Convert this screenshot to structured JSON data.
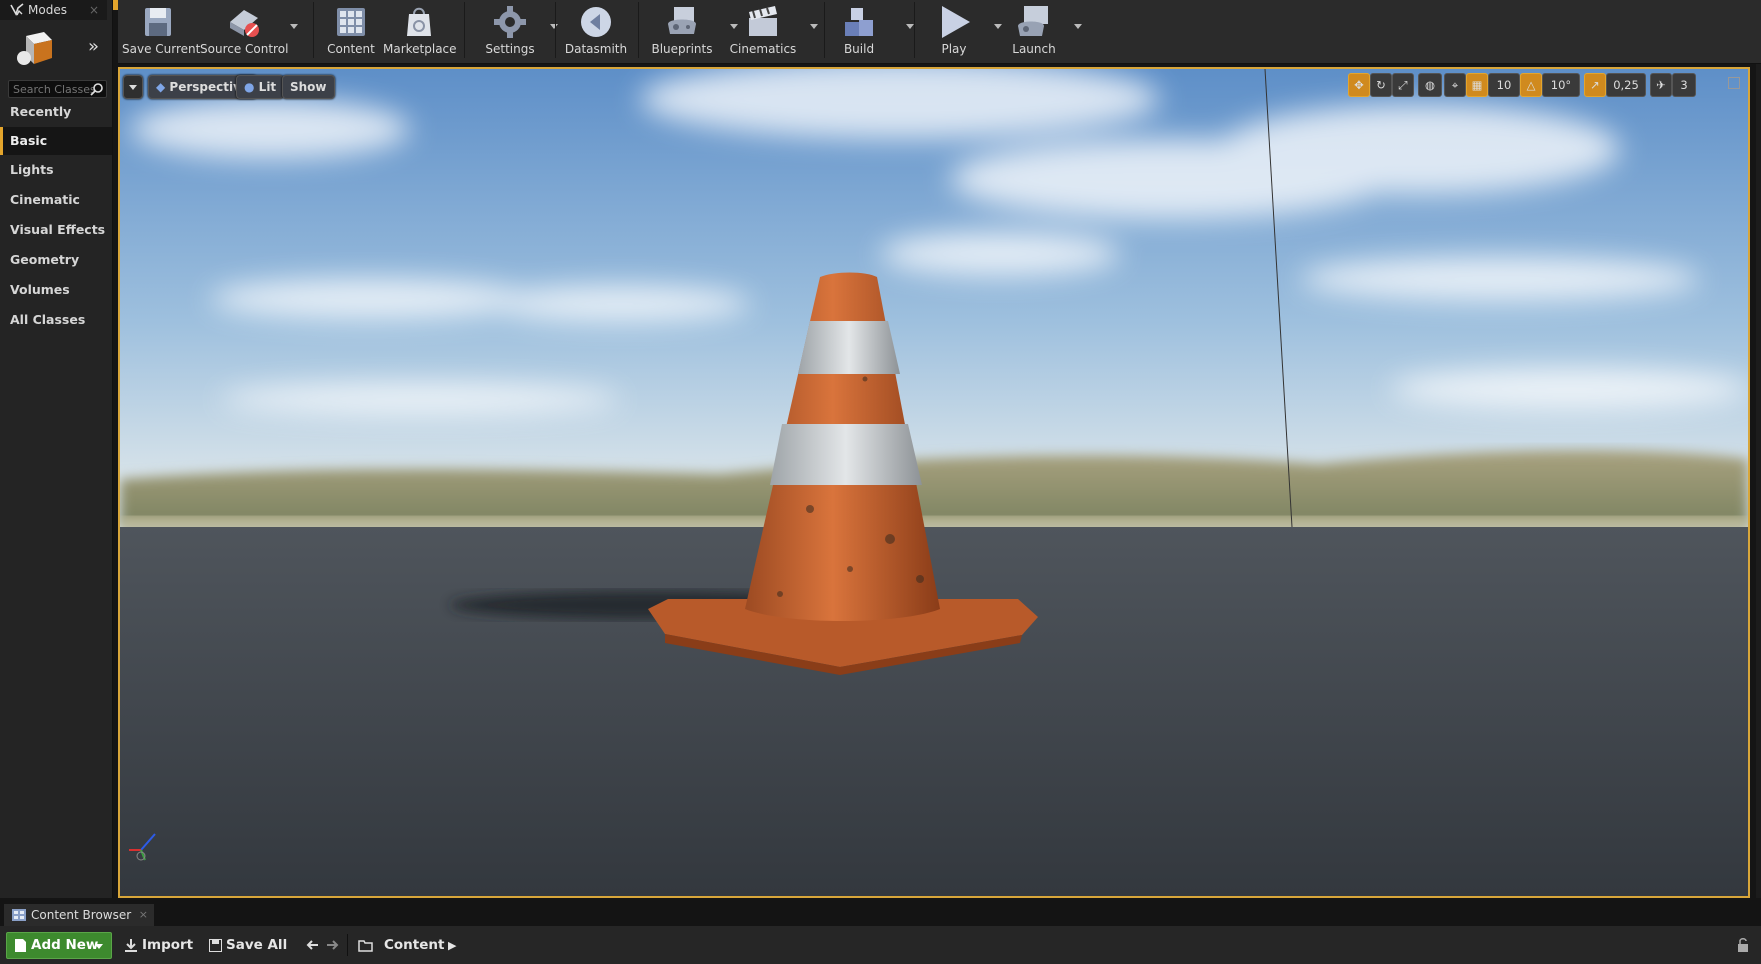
{
  "modes": {
    "title": "Modes",
    "search_placeholder": "Search Classes",
    "categories": [
      "Recently Placed",
      "Basic",
      "Lights",
      "Cinematic",
      "Visual Effects",
      "Geometry",
      "Volumes",
      "All Classes"
    ],
    "active_category": "Basic"
  },
  "toolbar": {
    "items": [
      "Save Current",
      "Source Control",
      "Content",
      "Marketplace",
      "Settings",
      "Datasmith",
      "Blueprints",
      "Cinematics",
      "Build",
      "Play",
      "Launch"
    ]
  },
  "viewport": {
    "view_mode": "Perspective",
    "lighting": "Lit",
    "show": "Show",
    "grid_snap": "10",
    "rotation_snap": "10°",
    "scale_snap": "0,25",
    "camera_speed": "3"
  },
  "content_browser": {
    "tab": "Content Browser",
    "add_new": "Add New",
    "import": "Import",
    "save_all": "Save All",
    "path": "Content"
  },
  "colors": {
    "accent": "#e4a52c",
    "add_new": "#3d8a2e",
    "panel": "#242424"
  }
}
